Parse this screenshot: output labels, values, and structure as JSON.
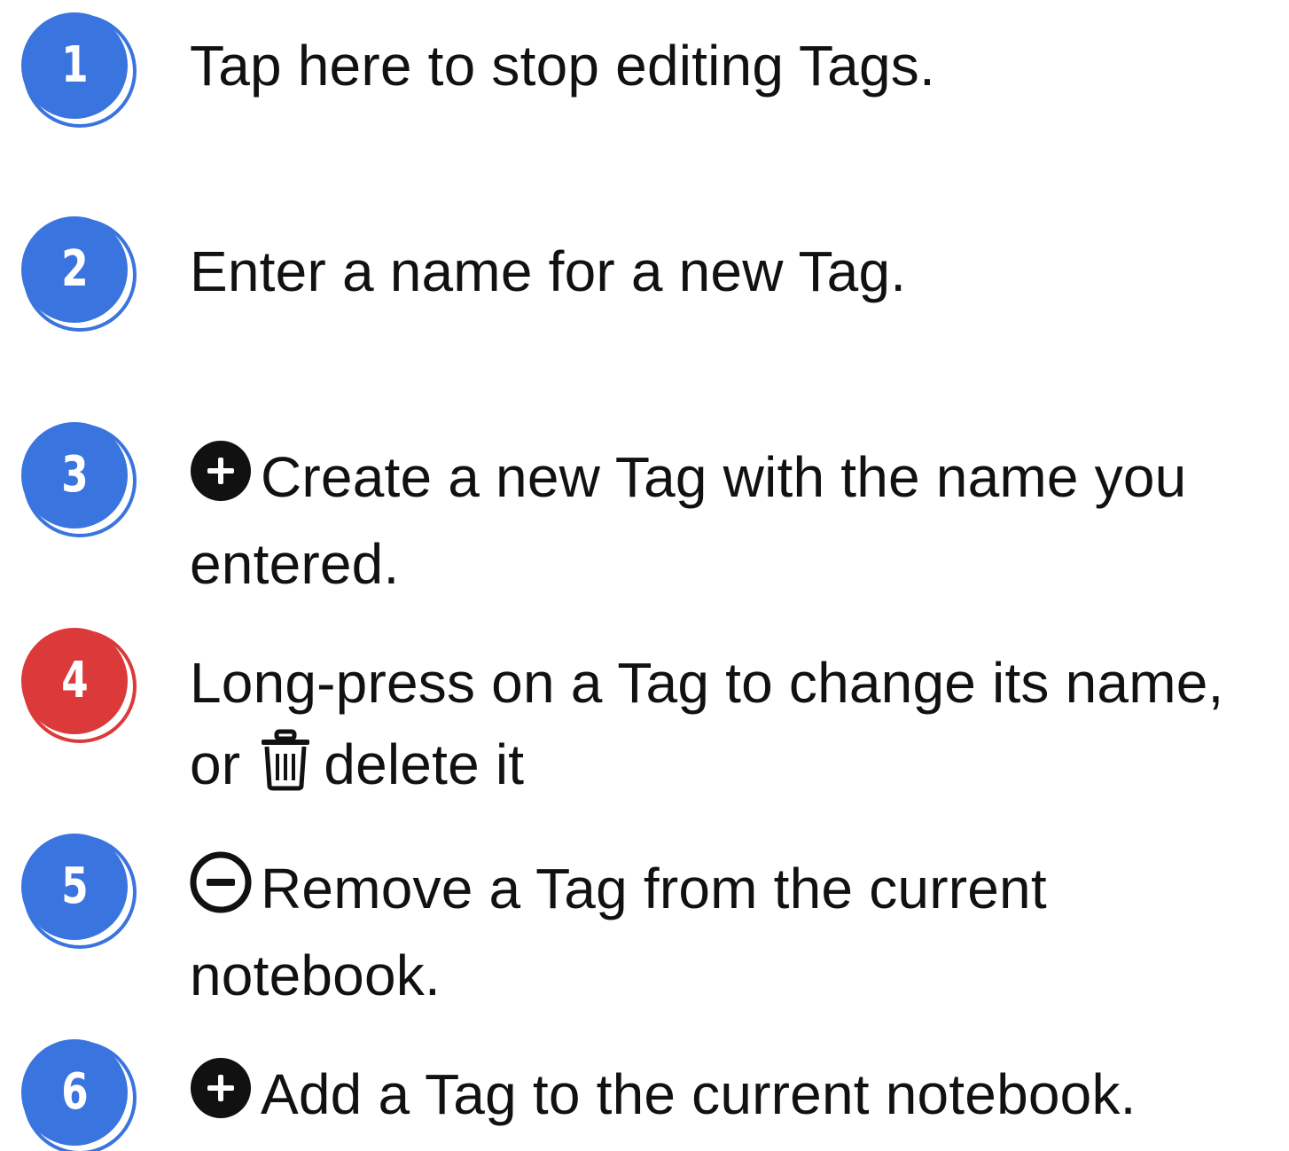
{
  "steps": [
    {
      "number": "1",
      "color": "#3a74de",
      "lines": [
        "Tap here to stop editing Tags."
      ]
    },
    {
      "number": "2",
      "color": "#3a74de",
      "lines": [
        "Enter a name for a new Tag."
      ]
    },
    {
      "number": "3",
      "color": "#3a74de",
      "icon": "plus-circle-filled-icon",
      "lines": [
        "Create a new Tag with the name you",
        "entered."
      ]
    },
    {
      "number": "4",
      "color": "#dc3a3a",
      "icon": "trash-icon",
      "lines": [
        "Long-press on a Tag to change its name,",
        "or",
        "delete it"
      ]
    },
    {
      "number": "5",
      "color": "#3a74de",
      "icon": "minus-circle-outline-icon",
      "lines": [
        "Remove a Tag from the current",
        "notebook."
      ]
    },
    {
      "number": "6",
      "color": "#3a74de",
      "icon": "plus-circle-filled-icon",
      "lines": [
        "Add a Tag to the current notebook."
      ]
    }
  ]
}
